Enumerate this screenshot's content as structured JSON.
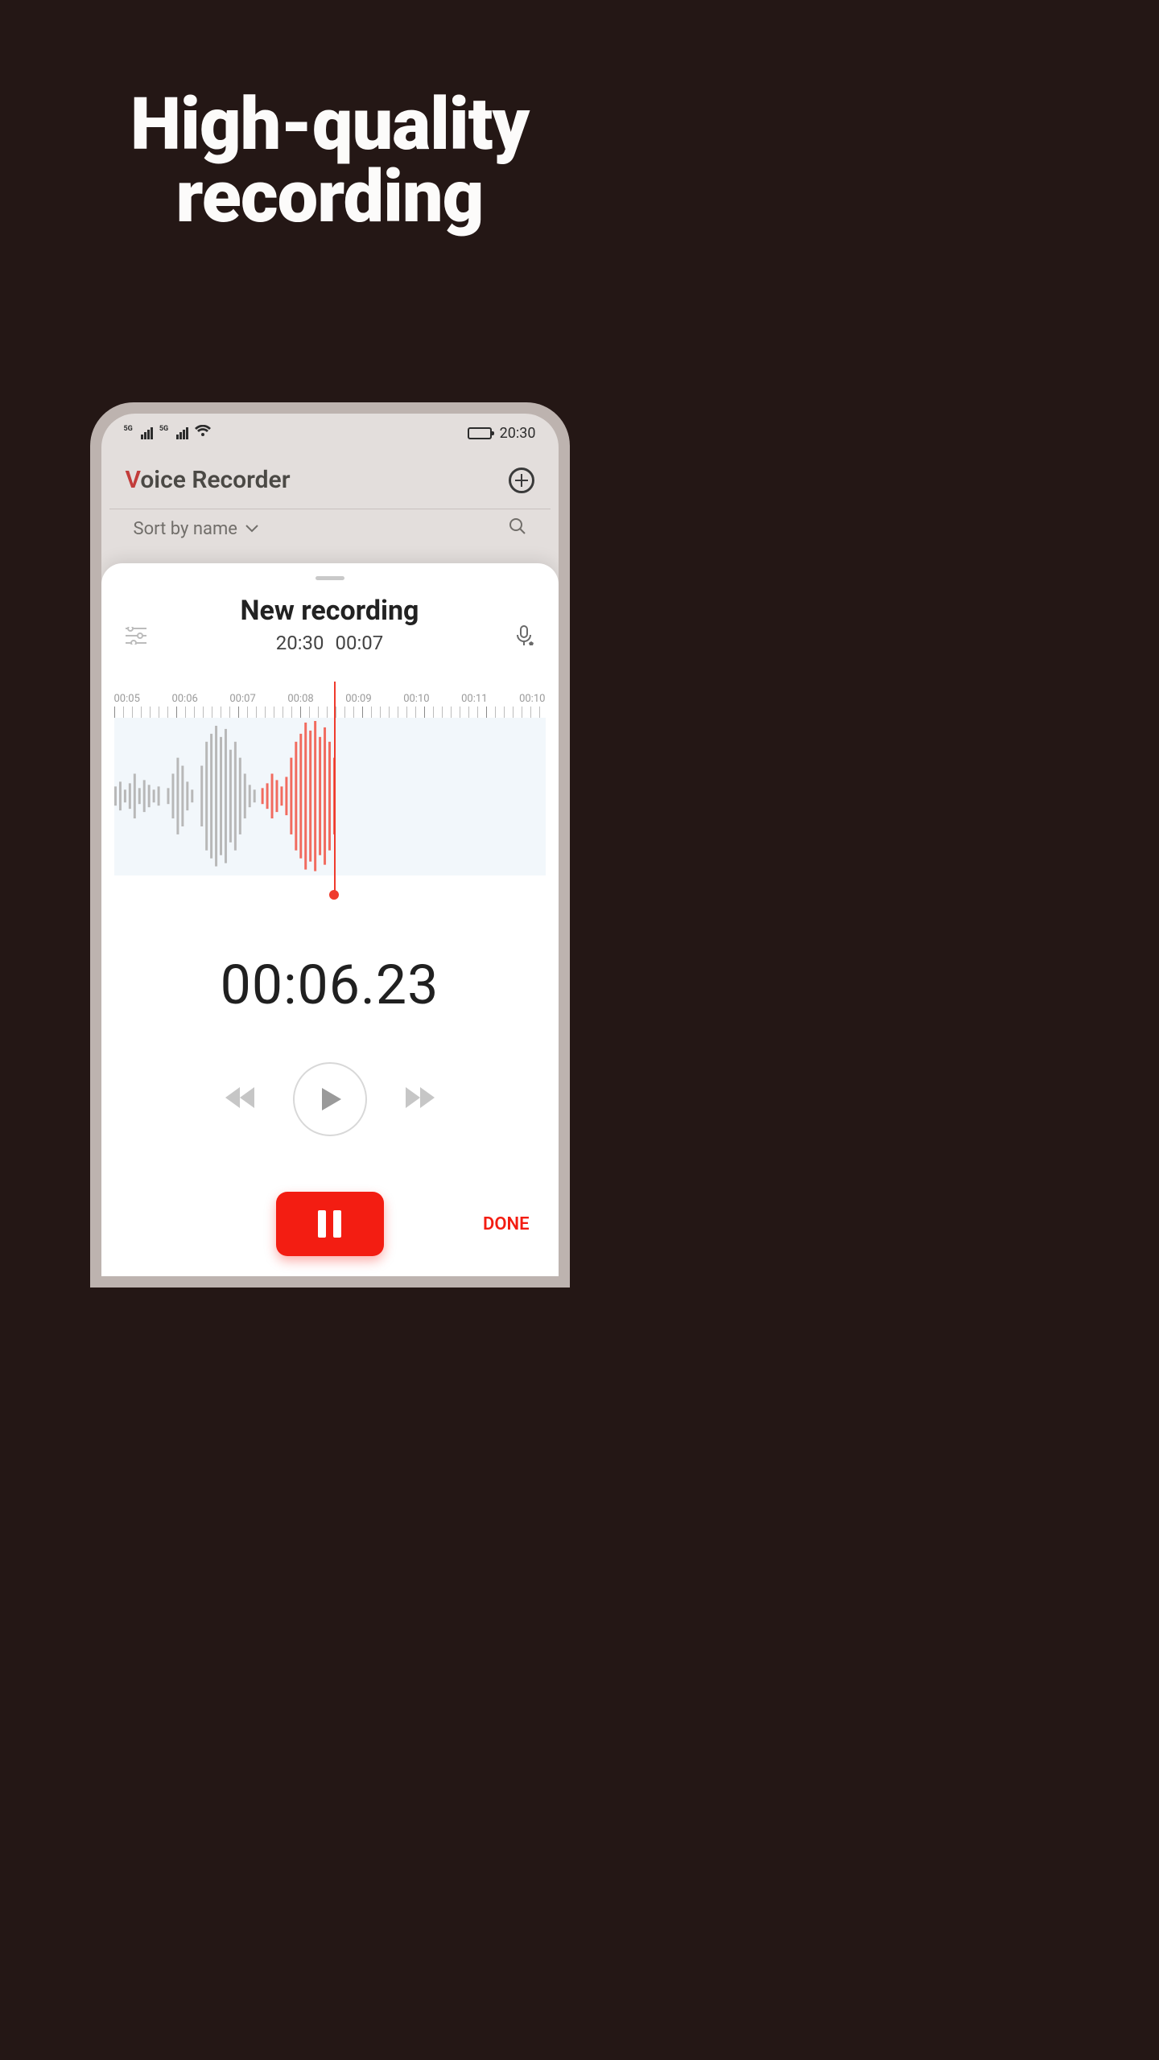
{
  "hero": {
    "line1": "High-quality",
    "line2": "recording"
  },
  "status": {
    "time": "20:30"
  },
  "app": {
    "title_first_letter": "V",
    "title_rest": "oice Recorder",
    "sort_label": "Sort by name"
  },
  "sheet": {
    "title": "New recording",
    "time": "20:30",
    "duration": "00:07",
    "timeline": [
      "00:05",
      "00:06",
      "00:07",
      "00:08",
      "00:09",
      "00:10",
      "00:11",
      "00:10"
    ],
    "elapsed": "00:06.23",
    "done_label": "DONE"
  },
  "colors": {
    "accent": "#f31d12"
  }
}
